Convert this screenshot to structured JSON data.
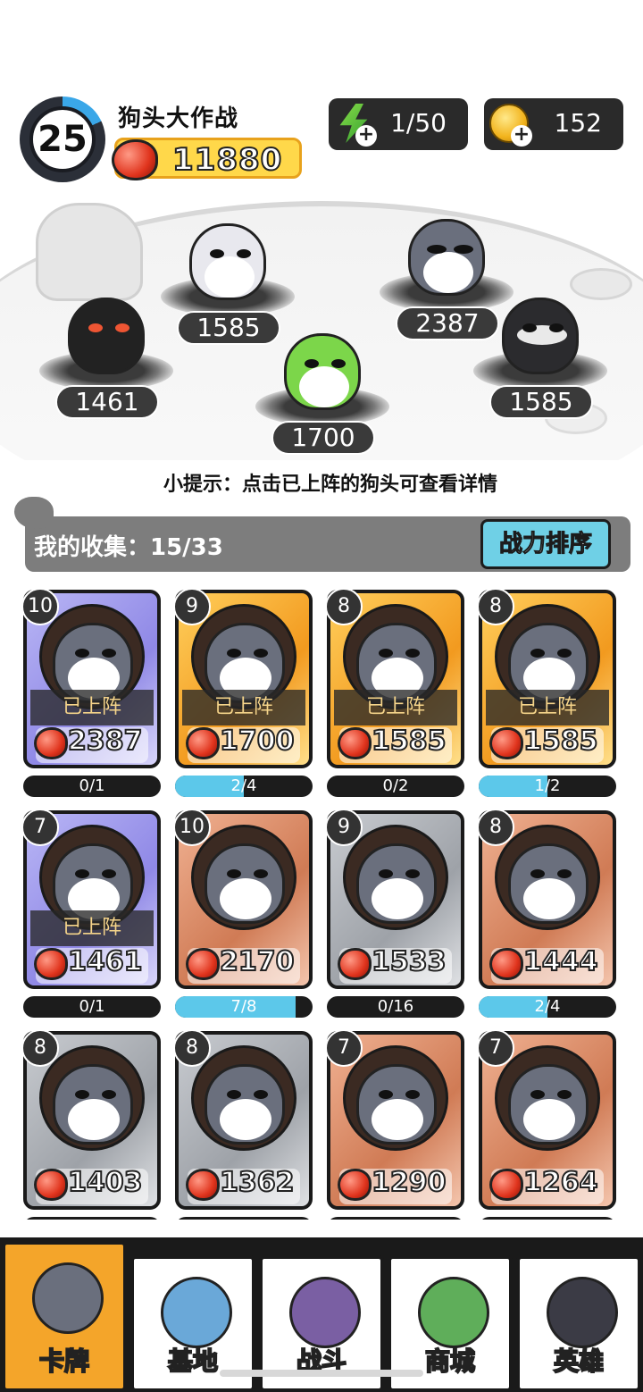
{
  "header": {
    "level": "25",
    "level_progress": 0.18,
    "player_name": "狗头大作战",
    "total_power": "11880",
    "energy": "1/50",
    "coins": "152"
  },
  "arena": {
    "slots": [
      {
        "power": "1585"
      },
      {
        "power": "2387"
      },
      {
        "power": "1461"
      },
      {
        "power": "1700"
      },
      {
        "power": "1585"
      }
    ]
  },
  "hint": "小提示：点击已上阵的狗头可查看详情",
  "collection": {
    "label": "我的收集：15/33",
    "sort_button": "战力排序"
  },
  "cards": [
    {
      "level": "10",
      "power": "2387",
      "on_field": "已上阵",
      "progress": "0/1",
      "progress_fraction": 0,
      "rarity": "purple"
    },
    {
      "level": "9",
      "power": "1700",
      "on_field": "已上阵",
      "progress": "2/4",
      "progress_fraction": 0.5,
      "rarity": "gold"
    },
    {
      "level": "8",
      "power": "1585",
      "on_field": "已上阵",
      "progress": "0/2",
      "progress_fraction": 0,
      "rarity": "gold"
    },
    {
      "level": "8",
      "power": "1585",
      "on_field": "已上阵",
      "progress": "1/2",
      "progress_fraction": 0.5,
      "rarity": "gold"
    },
    {
      "level": "7",
      "power": "1461",
      "on_field": "已上阵",
      "progress": "0/1",
      "progress_fraction": 0,
      "rarity": "purple"
    },
    {
      "level": "10",
      "power": "2170",
      "on_field": "",
      "progress": "7/8",
      "progress_fraction": 0.875,
      "rarity": "bronze"
    },
    {
      "level": "9",
      "power": "1533",
      "on_field": "",
      "progress": "0/16",
      "progress_fraction": 0,
      "rarity": "gray"
    },
    {
      "level": "8",
      "power": "1444",
      "on_field": "",
      "progress": "2/4",
      "progress_fraction": 0.5,
      "rarity": "bronze"
    },
    {
      "level": "8",
      "power": "1403",
      "on_field": "",
      "progress": "",
      "progress_fraction": 0,
      "rarity": "gray"
    },
    {
      "level": "8",
      "power": "1362",
      "on_field": "",
      "progress": "",
      "progress_fraction": 0,
      "rarity": "gray"
    },
    {
      "level": "7",
      "power": "1290",
      "on_field": "",
      "progress": "",
      "progress_fraction": 0,
      "rarity": "bronze"
    },
    {
      "level": "7",
      "power": "1264",
      "on_field": "",
      "progress": "",
      "progress_fraction": 0,
      "rarity": "bronze"
    }
  ],
  "nav": [
    {
      "label": "卡牌",
      "icon": "dog-card-icon",
      "active": true
    },
    {
      "label": "基地",
      "icon": "castle-icon",
      "active": false
    },
    {
      "label": "战斗",
      "icon": "paw-icon",
      "active": false
    },
    {
      "label": "商城",
      "icon": "money-icon",
      "active": false
    },
    {
      "label": "英雄",
      "icon": "hero-dog-icon",
      "active": false
    }
  ],
  "colors": {
    "accent_blue": "#5cc8ea",
    "active_tab": "#f4a52a",
    "power_bar": "#ffd84a"
  }
}
